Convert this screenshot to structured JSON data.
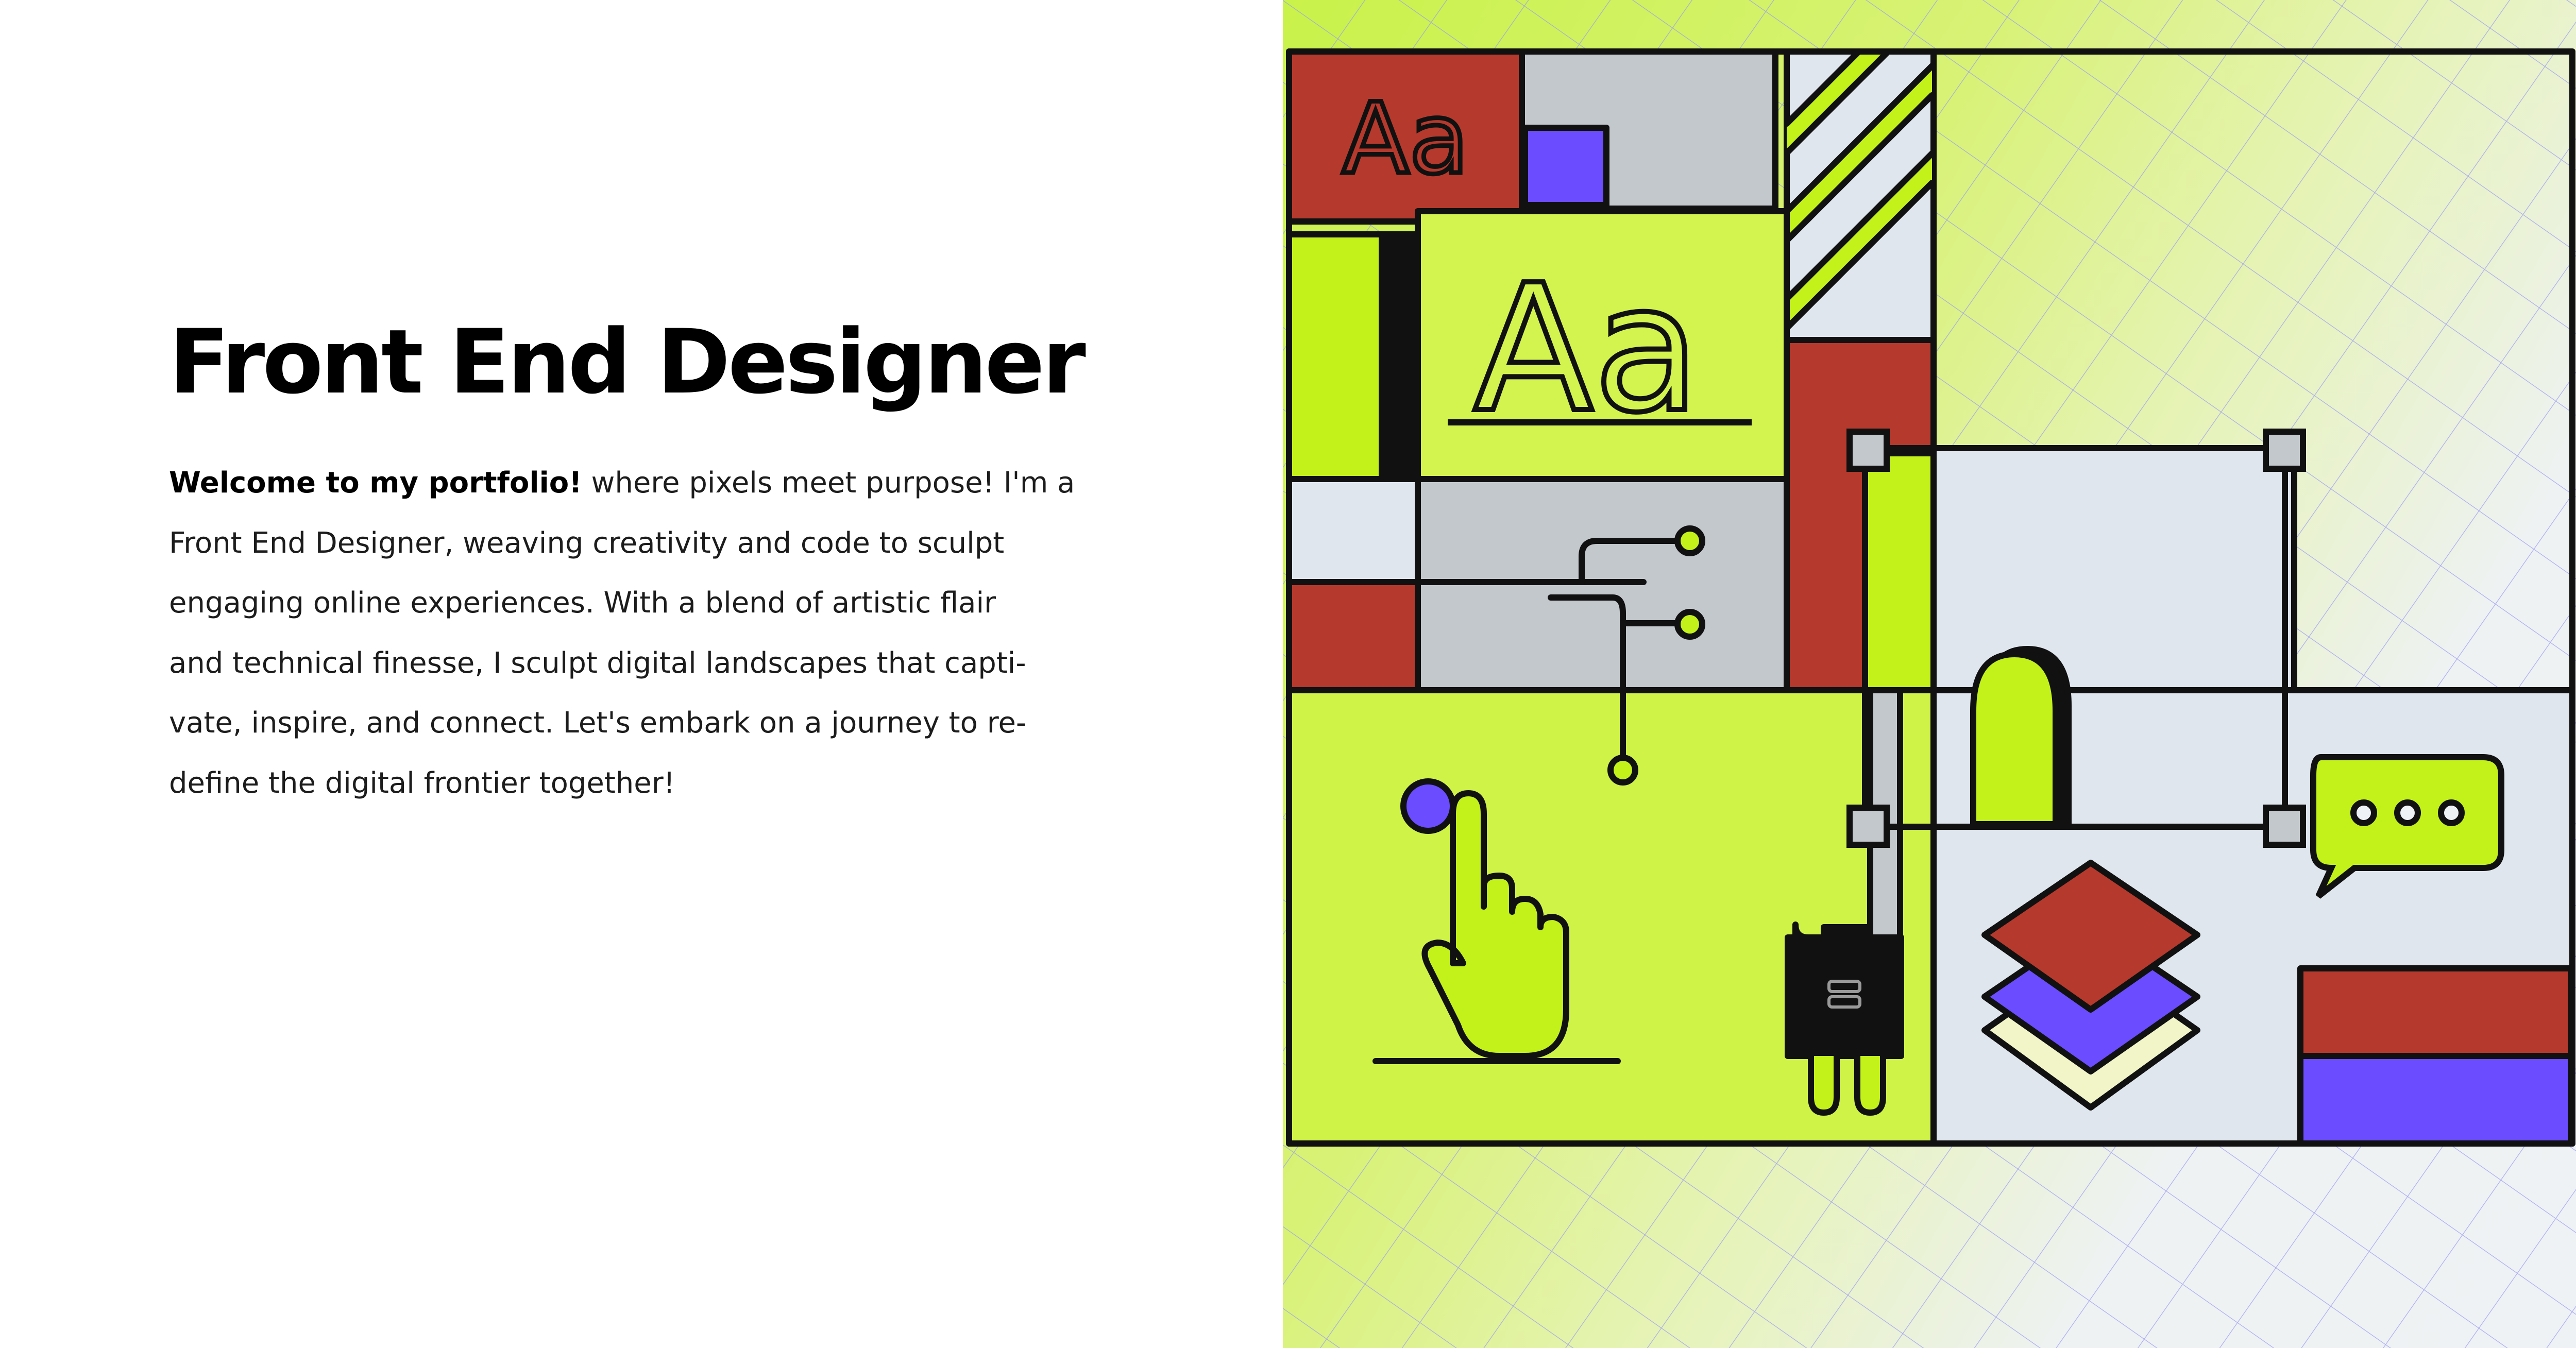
{
  "hero": {
    "title": "Front End Designer",
    "intro_bold": "Welcome to my portfolio!",
    "intro_lines": [
      " where pixels meet purpose! I'm a",
      "Front End Designer, weaving creativity and code to sculpt",
      "engaging online experiences. With a blend of artistic flair",
      "and technical finesse, I sculpt digital landscapes that capti-",
      "vate, inspire, and connect. Let's embark on a journey to re-",
      "define the digital frontier together!"
    ]
  },
  "illustration": {
    "typography_small": "Aa",
    "typography_large": "Aa",
    "colors": {
      "lime": "#c3f21a",
      "red": "#b5392c",
      "purple": "#6b4cff",
      "gray": "#c3c8cc",
      "pale_blue": "#dfe6ee",
      "black": "#111111",
      "grid_line": "#9c9bf2"
    },
    "icons": [
      "type-sample-icon",
      "pointing-hand-icon",
      "hdmi-plug-icon",
      "branch-connector-icon",
      "layers-stack-icon",
      "chat-bubble-icon",
      "arch-doorway-icon",
      "selection-frame-icon"
    ]
  }
}
